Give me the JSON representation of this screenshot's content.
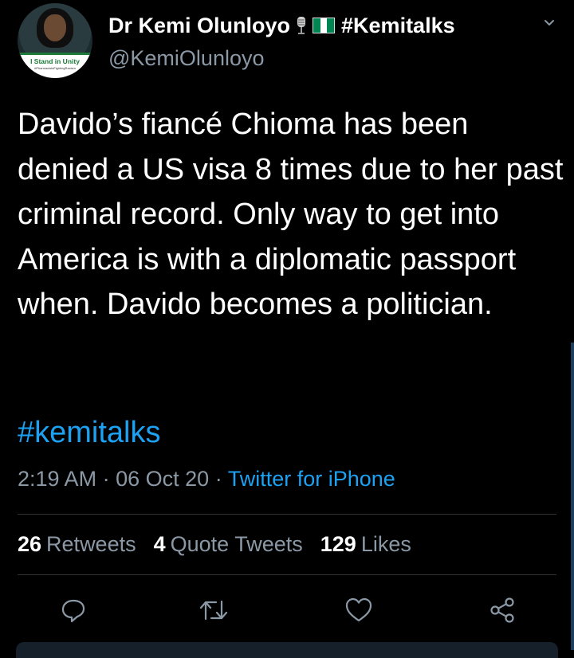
{
  "author": {
    "display_name": "Dr Kemi Olunloyo",
    "hashtag_in_name": "#Kemitalks",
    "handle": "@KemiOlunloyo",
    "avatar_banner": "I Stand in Unity",
    "avatar_banner_sub": "#PharmacistsFightingRacism"
  },
  "tweet": {
    "text": "Davido’s fiancé Chioma has been denied a US visa 8 times due to her past criminal record. Only way to get into America is with a diplomatic passport when. Davido becomes a politician.",
    "hashtag": "#kemitalks",
    "time": "2:19 AM",
    "date": "06 Oct 20",
    "source": "Twitter for iPhone",
    "separator": "·"
  },
  "stats": {
    "retweets_count": "26",
    "retweets_label": "Retweets",
    "quote_count": "4",
    "quote_label": "Quote Tweets",
    "likes_count": "129",
    "likes_label": "Likes"
  },
  "icons": {
    "reply": "reply-icon",
    "retweet": "retweet-icon",
    "like": "heart-icon",
    "share": "share-icon",
    "more": "chevron-down-icon"
  },
  "colors": {
    "background": "#000000",
    "text": "#ffffff",
    "secondary": "#8b98a5",
    "link": "#1da1f2",
    "flag_green": "#008751"
  }
}
